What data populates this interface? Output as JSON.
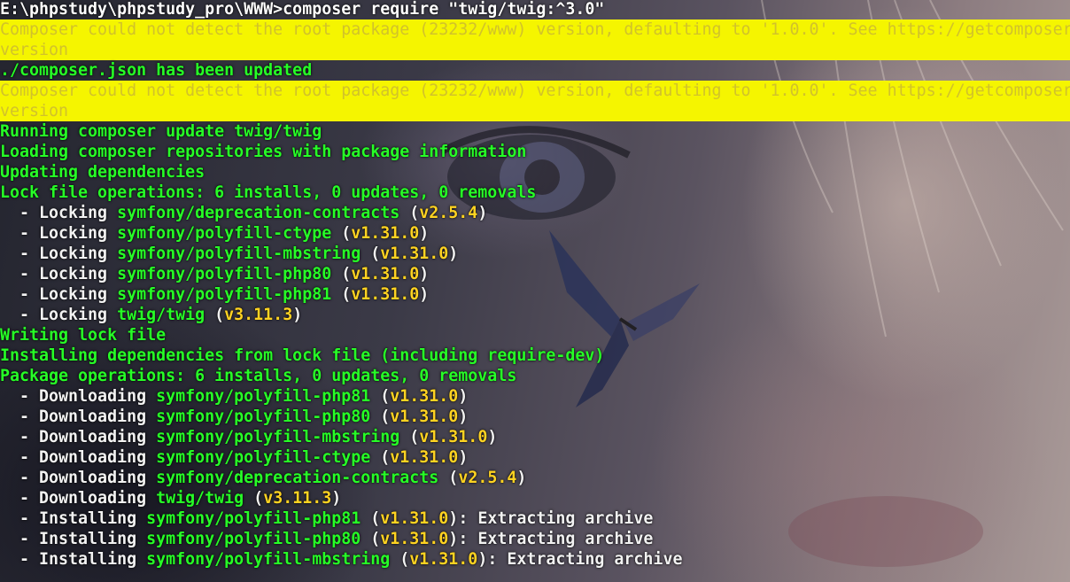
{
  "command_line": "E:\\phpstudy\\phpstudy_pro\\WWW>composer require \"twig/twig:^3.0\"",
  "warning_1": {
    "line_a": "Composer could not detect the root package (23232/www) version, defaulting to '1.0.0'. See https://getcomposer.org/root-",
    "line_b": "version"
  },
  "updated_msg": "./composer.json has been updated",
  "warning_2": {
    "line_a": "Composer could not detect the root package (23232/www) version, defaulting to '1.0.0'. See https://getcomposer.org/root-",
    "line_b": "version"
  },
  "status": {
    "running": "Running composer update twig/twig",
    "loading": "Loading composer repositories with package information",
    "updating": "Updating dependencies",
    "lock_ops": "Lock file operations: 6 installs, 0 updates, 0 removals",
    "writing": "Writing lock file",
    "installing_deps": "Installing dependencies from lock file (including require-dev)",
    "package_ops": "Package operations: 6 installs, 0 updates, 0 removals"
  },
  "locking": [
    {
      "action": "  - Locking ",
      "pkg": "symfony/deprecation-contracts",
      "ver": "v2.5.4"
    },
    {
      "action": "  - Locking ",
      "pkg": "symfony/polyfill-ctype",
      "ver": "v1.31.0"
    },
    {
      "action": "  - Locking ",
      "pkg": "symfony/polyfill-mbstring",
      "ver": "v1.31.0"
    },
    {
      "action": "  - Locking ",
      "pkg": "symfony/polyfill-php80",
      "ver": "v1.31.0"
    },
    {
      "action": "  - Locking ",
      "pkg": "symfony/polyfill-php81",
      "ver": "v1.31.0"
    },
    {
      "action": "  - Locking ",
      "pkg": "twig/twig",
      "ver": "v3.11.3"
    }
  ],
  "downloading": [
    {
      "action": "  - Downloading ",
      "pkg": "symfony/polyfill-php81",
      "ver": "v1.31.0"
    },
    {
      "action": "  - Downloading ",
      "pkg": "symfony/polyfill-php80",
      "ver": "v1.31.0"
    },
    {
      "action": "  - Downloading ",
      "pkg": "symfony/polyfill-mbstring",
      "ver": "v1.31.0"
    },
    {
      "action": "  - Downloading ",
      "pkg": "symfony/polyfill-ctype",
      "ver": "v1.31.0"
    },
    {
      "action": "  - Downloading ",
      "pkg": "symfony/deprecation-contracts",
      "ver": "v2.5.4"
    },
    {
      "action": "  - Downloading ",
      "pkg": "twig/twig",
      "ver": "v3.11.3"
    }
  ],
  "installing": [
    {
      "action": "  - Installing ",
      "pkg": "symfony/polyfill-php81",
      "ver": "v1.31.0",
      "suffix": ": Extracting archive"
    },
    {
      "action": "  - Installing ",
      "pkg": "symfony/polyfill-php80",
      "ver": "v1.31.0",
      "suffix": ": Extracting archive"
    },
    {
      "action": "  - Installing ",
      "pkg": "symfony/polyfill-mbstring",
      "ver": "v1.31.0",
      "suffix": ": Extracting archive"
    }
  ],
  "colors": {
    "info": "#27ff27",
    "text": "#f2f2f2",
    "version": "#ffd322",
    "warning_bg": "#f5f500",
    "warning_text": "#d1c22a"
  }
}
